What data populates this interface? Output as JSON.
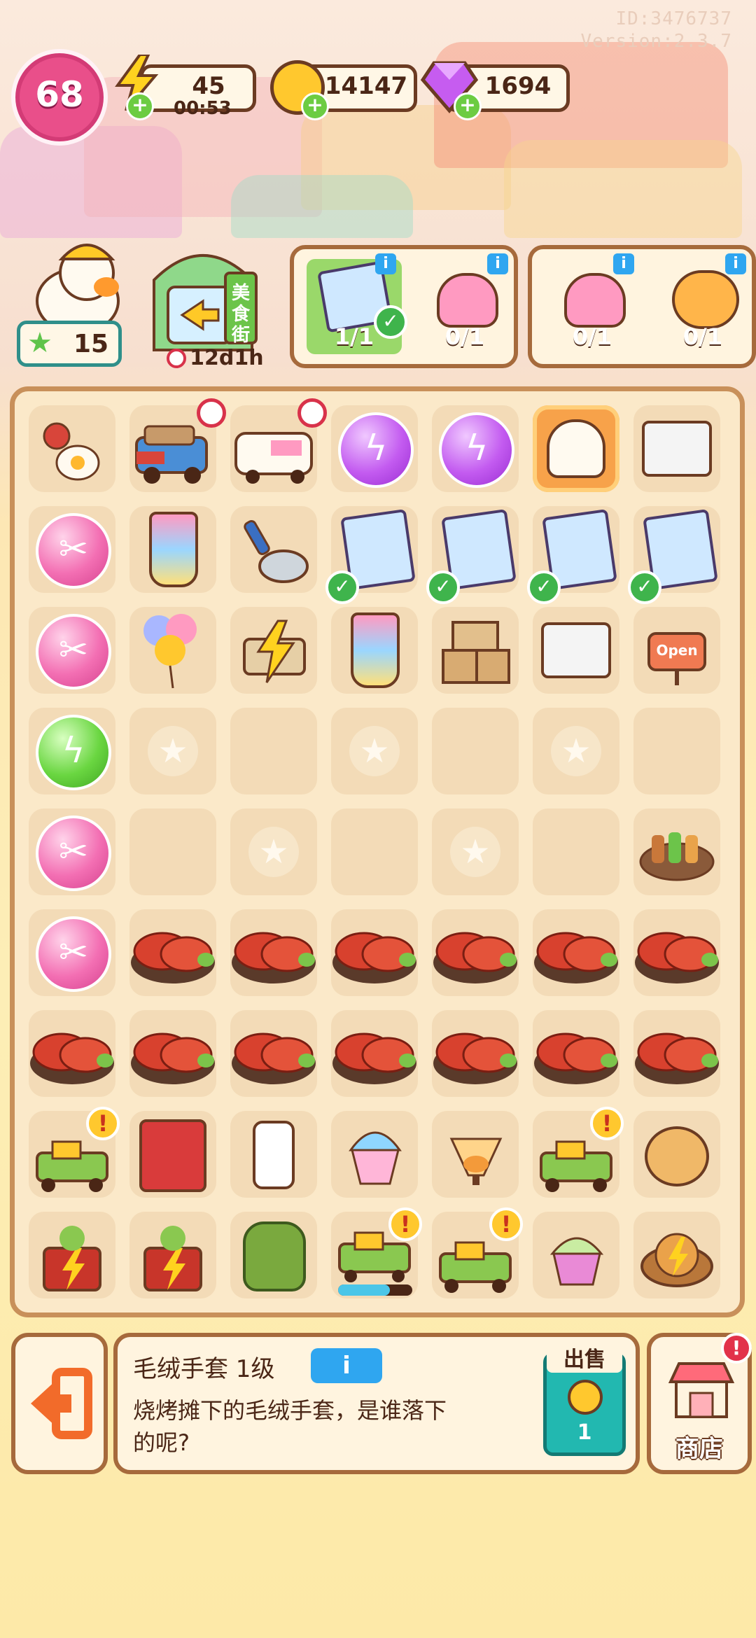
{
  "header": {
    "id_text": "ID:3476737",
    "version_text": "Version:2.3.7",
    "level": "68",
    "energy": "45",
    "energy_timer": "00:53",
    "coins": "14147",
    "gems": "1694"
  },
  "character": {
    "star_count": "15"
  },
  "food_street": {
    "sign": "美食街",
    "timer": "12d1h"
  },
  "quests": [
    {
      "progress": "1/1",
      "complete": true
    },
    {
      "progress": "0/1",
      "complete": false
    },
    {
      "progress": "0/1",
      "complete": false
    },
    {
      "progress": "0/1",
      "complete": false
    }
  ],
  "board_items": {
    "shop_sign": "Open"
  },
  "detail": {
    "title": "毛绒手套 1级",
    "info_label": "i",
    "description_line1": "烧烤摊下的毛绒手套，是谁落下",
    "description_line2": "的呢?",
    "sell_label": "出售",
    "sell_value": "1",
    "shop_label": "商店",
    "shop_badge": "!"
  },
  "colors": {
    "accent_brown": "#a66a3c",
    "level_pink": "#e94f8a",
    "info_blue": "#2fa6f0",
    "sell_teal": "#22b8b0",
    "exit_orange": "#f26b2a"
  }
}
